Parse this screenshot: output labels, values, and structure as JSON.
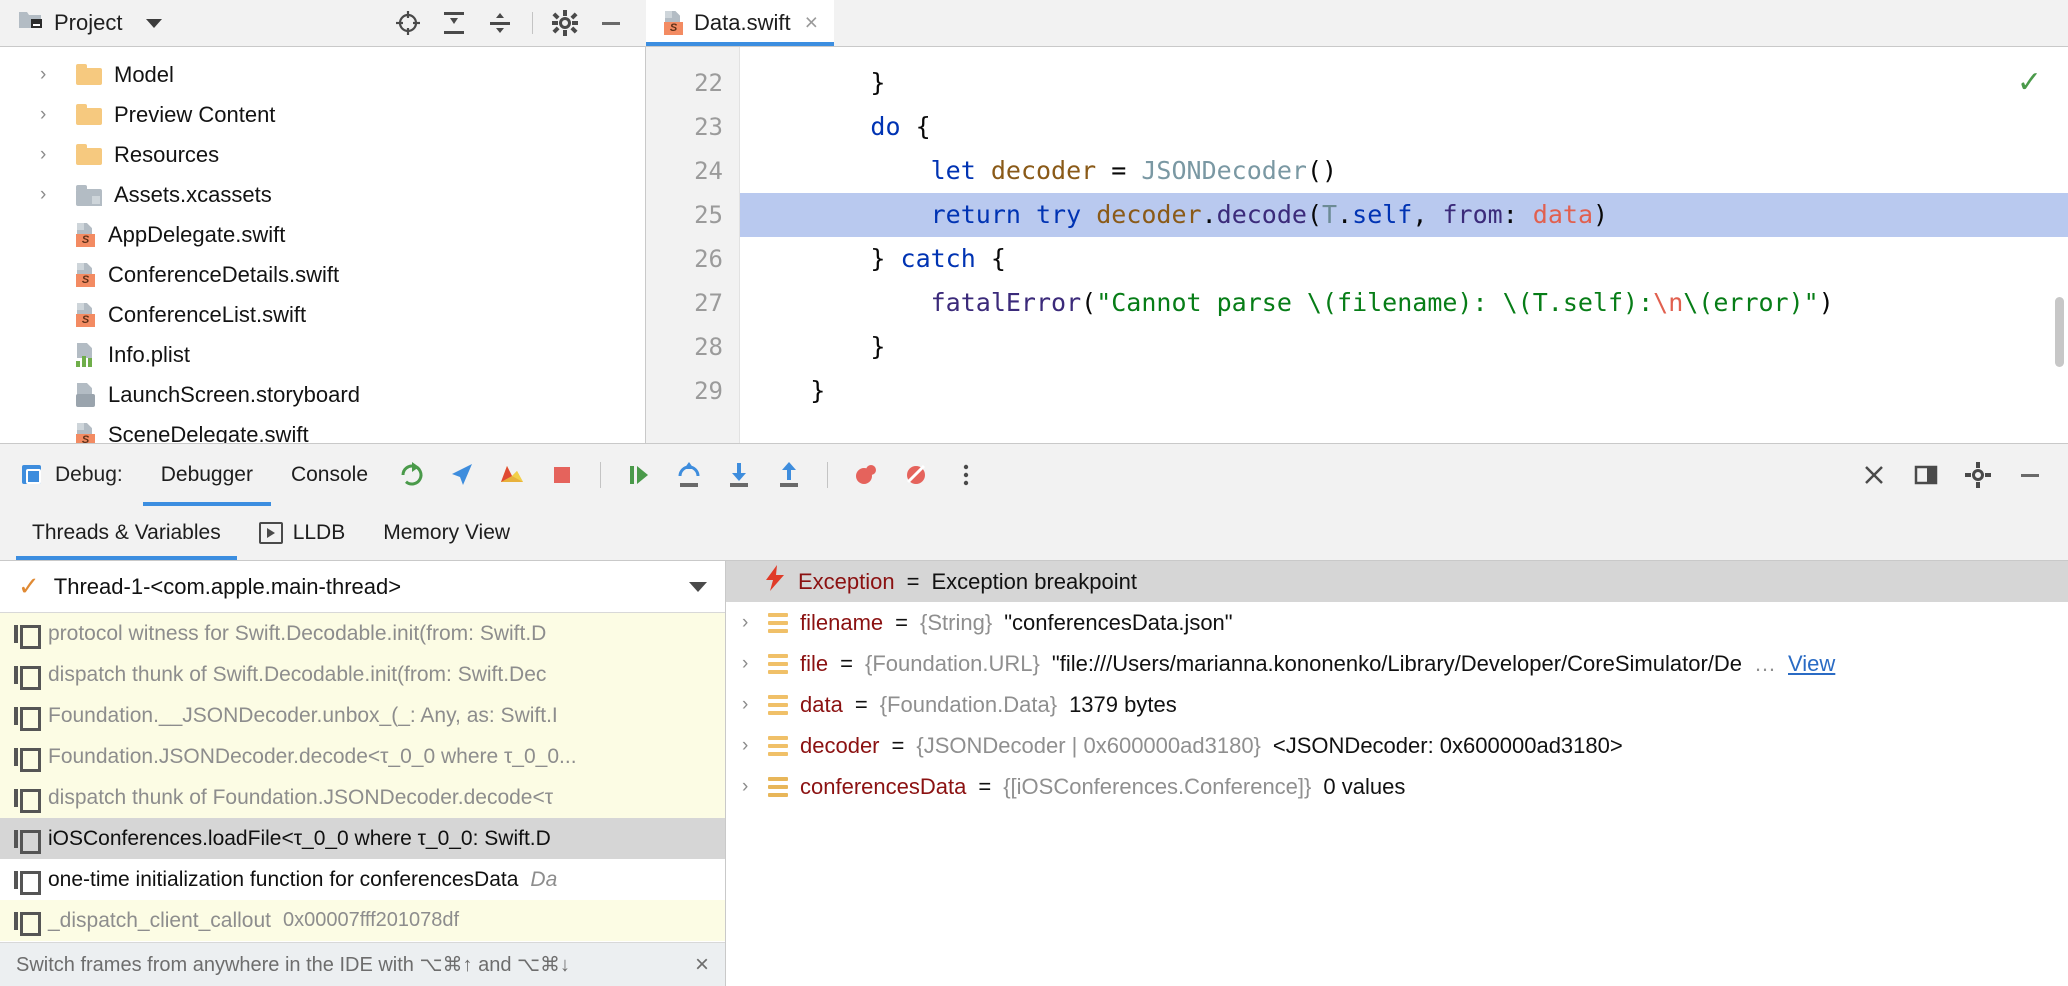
{
  "project_toolbar": {
    "label": "Project",
    "icons": [
      "locate-icon",
      "expand-all-icon",
      "collapse-all-icon",
      "gear-icon",
      "minimize-icon"
    ]
  },
  "tabs": [
    {
      "label": "Data.swift",
      "icon": "swift-file-icon",
      "close": "×",
      "active": true
    }
  ],
  "tree": [
    {
      "label": "Model",
      "icon": "folder-icon",
      "arrow": "›"
    },
    {
      "label": "Preview Content",
      "icon": "folder-icon",
      "arrow": "›"
    },
    {
      "label": "Resources",
      "icon": "folder-icon",
      "arrow": "›"
    },
    {
      "label": "Assets.xcassets",
      "icon": "xcassets-icon",
      "arrow": "›"
    },
    {
      "label": "AppDelegate.swift",
      "icon": "swift-file-icon",
      "arrow": ""
    },
    {
      "label": "ConferenceDetails.swift",
      "icon": "swift-file-icon",
      "arrow": ""
    },
    {
      "label": "ConferenceList.swift",
      "icon": "swift-file-icon",
      "arrow": ""
    },
    {
      "label": "Info.plist",
      "icon": "plist-file-icon",
      "arrow": ""
    },
    {
      "label": "LaunchScreen.storyboard",
      "icon": "storyboard-file-icon",
      "arrow": ""
    },
    {
      "label": "SceneDelegate.swift",
      "icon": "swift-file-icon",
      "arrow": ""
    }
  ],
  "editor": {
    "line_numbers": [
      "22",
      "23",
      "24",
      "25",
      "26",
      "27",
      "28",
      "29"
    ],
    "highlighted_line": "25",
    "inspection_status": "✓",
    "lines": [
      {
        "n": "22",
        "tokens": [
          {
            "t": "        }",
            "c": ""
          }
        ]
      },
      {
        "n": "23",
        "tokens": [
          {
            "t": "        ",
            "c": ""
          },
          {
            "t": "do",
            "c": "kw"
          },
          {
            "t": " {",
            "c": ""
          }
        ]
      },
      {
        "n": "24",
        "tokens": [
          {
            "t": "            ",
            "c": ""
          },
          {
            "t": "let",
            "c": "kw"
          },
          {
            "t": " ",
            "c": ""
          },
          {
            "t": "decoder",
            "c": "prop"
          },
          {
            "t": " = ",
            "c": ""
          },
          {
            "t": "JSONDecoder",
            "c": "typ"
          },
          {
            "t": "()",
            "c": ""
          }
        ]
      },
      {
        "n": "25",
        "tokens": [
          {
            "t": "            ",
            "c": ""
          },
          {
            "t": "return",
            "c": "kw"
          },
          {
            "t": " ",
            "c": ""
          },
          {
            "t": "try",
            "c": "kw"
          },
          {
            "t": " ",
            "c": ""
          },
          {
            "t": "decoder",
            "c": "prop"
          },
          {
            "t": ".",
            "c": ""
          },
          {
            "t": "decode",
            "c": "fn"
          },
          {
            "t": "(",
            "c": ""
          },
          {
            "t": "T",
            "c": "tgen"
          },
          {
            "t": ".",
            "c": ""
          },
          {
            "t": "self",
            "c": "kw"
          },
          {
            "t": ", ",
            "c": ""
          },
          {
            "t": "from",
            "c": "fn"
          },
          {
            "t": ": ",
            "c": ""
          },
          {
            "t": "data",
            "c": "red"
          },
          {
            "t": ")",
            "c": ""
          }
        ]
      },
      {
        "n": "26",
        "tokens": [
          {
            "t": "        } ",
            "c": ""
          },
          {
            "t": "catch",
            "c": "kw"
          },
          {
            "t": " {",
            "c": ""
          }
        ]
      },
      {
        "n": "27",
        "tokens": [
          {
            "t": "            ",
            "c": ""
          },
          {
            "t": "fatalError",
            "c": "fn"
          },
          {
            "t": "(",
            "c": ""
          },
          {
            "t": "\"Cannot parse ",
            "c": "str"
          },
          {
            "t": "\\(filename)",
            "c": "str"
          },
          {
            "t": ": ",
            "c": "str"
          },
          {
            "t": "\\(T.self)",
            "c": "str"
          },
          {
            "t": ":",
            "c": "str"
          },
          {
            "t": "\\n",
            "c": "red"
          },
          {
            "t": "\\(error)",
            "c": "str"
          },
          {
            "t": "\"",
            "c": "str"
          },
          {
            "t": ")",
            "c": ""
          }
        ]
      },
      {
        "n": "28",
        "tokens": [
          {
            "t": "        }",
            "c": ""
          }
        ]
      },
      {
        "n": "29",
        "tokens": [
          {
            "t": "    }",
            "c": ""
          }
        ]
      }
    ]
  },
  "debug_toolbar": {
    "title": "Debug:",
    "tabs": [
      {
        "label": "Debugger",
        "selected": true
      },
      {
        "label": "Console",
        "selected": false
      }
    ],
    "buttons": [
      "rerun-icon",
      "navigate-icon",
      "show-breakpoints-icon",
      "stop-icon",
      "resume-icon",
      "step-over-icon",
      "step-into-icon",
      "step-out-icon",
      "view-breakpoints-icon",
      "mute-breakpoints-icon",
      "more-options-icon"
    ],
    "right_buttons": [
      "close-icon",
      "layout-icon",
      "settings-icon",
      "minimize-icon"
    ]
  },
  "debug_subtabs": [
    {
      "label": "Threads & Variables",
      "selected": true,
      "icon": ""
    },
    {
      "label": "LLDB",
      "selected": false,
      "icon": "lldb-icon"
    },
    {
      "label": "Memory View",
      "selected": false,
      "icon": ""
    }
  ],
  "thread_selector": {
    "check": "✓",
    "label": "Thread-1-<com.apple.main-thread>",
    "caret": "chevron-down-icon"
  },
  "frames": [
    {
      "text": "protocol witness for Swift.Decodable.init(from: Swift.D",
      "style": "dim"
    },
    {
      "text": "dispatch thunk of Swift.Decodable.init(from: Swift.Dec",
      "style": "dim"
    },
    {
      "text": "Foundation.__JSONDecoder.unbox_(_: Any, as: Swift.I",
      "style": "dim"
    },
    {
      "text": "Foundation.JSONDecoder.decode<τ_0_0 where τ_0_0...",
      "style": "dim"
    },
    {
      "text": "dispatch thunk of Foundation.JSONDecoder.decode<τ",
      "style": "dim"
    },
    {
      "text": "iOSConferences.loadFile<τ_0_0 where τ_0_0: Swift.D",
      "style": "selected"
    },
    {
      "text": "one-time initialization function for conferencesData",
      "sub": "Da",
      "style": "plain"
    },
    {
      "text": "_dispatch_client_callout",
      "addr": "0x00007fff201078df",
      "style": "dim"
    }
  ],
  "frames_hint": {
    "text": "Switch frames from anywhere in the IDE with ⌥⌘↑ and ⌥⌘↓",
    "close": "×"
  },
  "variables": [
    {
      "kind": "exception",
      "bolt": "⚡",
      "name": "Exception",
      "eq": "=",
      "value": "Exception breakpoint"
    },
    {
      "kind": "var",
      "expand": "›",
      "icon": "value-icon",
      "name": "filename",
      "eq": "=",
      "type": "{String}",
      "value": "\"conferencesData.json\""
    },
    {
      "kind": "var",
      "expand": "›",
      "icon": "value-icon",
      "name": "file",
      "eq": "=",
      "type": "{Foundation.URL}",
      "value": "\"file:///Users/marianna.kononenko/Library/Developer/CoreSimulator/De",
      "ellipsis": "…",
      "link": "View"
    },
    {
      "kind": "var",
      "expand": "›",
      "icon": "value-icon",
      "name": "data",
      "eq": "=",
      "type": "{Foundation.Data}",
      "value": "1379 bytes"
    },
    {
      "kind": "var",
      "expand": "›",
      "icon": "value-icon",
      "name": "decoder",
      "eq": "=",
      "type": "{JSONDecoder | 0x600000ad3180}",
      "value": "<JSONDecoder: 0x600000ad3180>"
    },
    {
      "kind": "var",
      "expand": "›",
      "icon": "array-icon",
      "name": "conferencesData",
      "eq": "=",
      "type": "{[iOSConferences.Conference]}",
      "value": "0 values"
    }
  ],
  "colors": {
    "accent": "#3c8ee0",
    "highlight_line": "#b9c9ef",
    "frame_bg": "#fcfce4",
    "selected_frame": "#d6d6d6",
    "keyword": "#0033b3",
    "string": "#077d17",
    "error_red": "#8b1111"
  }
}
